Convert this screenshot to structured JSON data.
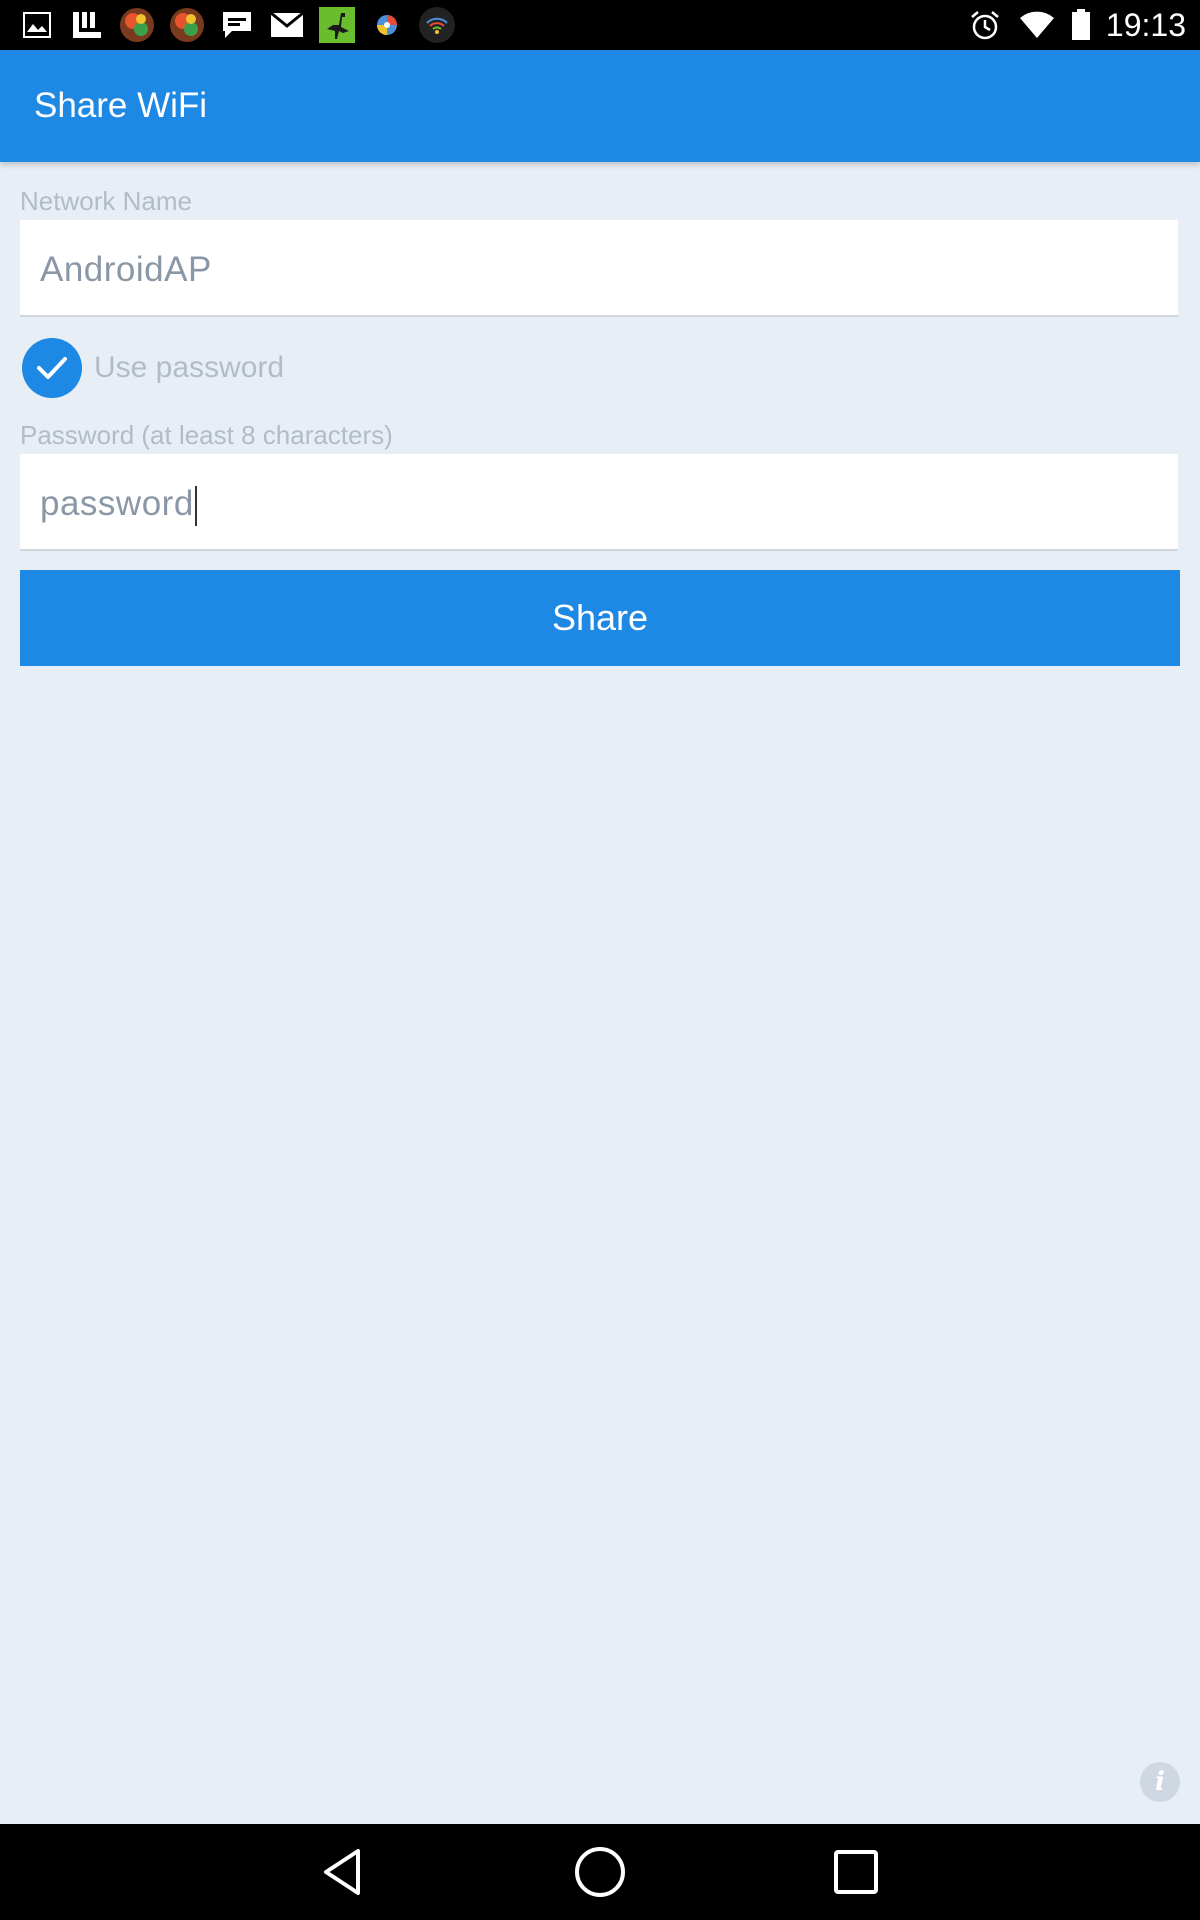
{
  "status_bar": {
    "time": "19:13",
    "notification_icons": [
      "image-icon",
      "app-icon",
      "game-icon",
      "game-icon",
      "chat-icon",
      "mail-icon",
      "ostrich-icon",
      "ball-icon",
      "wifi-app-icon"
    ],
    "status_icons": [
      "alarm-icon",
      "wifi-icon",
      "battery-icon"
    ]
  },
  "app_bar": {
    "title": "Share WiFi"
  },
  "form": {
    "network_name_label": "Network Name",
    "network_name_value": "AndroidAP",
    "use_password_label": "Use password",
    "use_password_checked": true,
    "password_label": "Password (at least 8 characters)",
    "password_value": "password",
    "share_button": "Share"
  },
  "info_button": {
    "glyph": "i"
  },
  "nav_bar": {
    "buttons": [
      "back-icon",
      "home-icon",
      "recents-icon"
    ]
  },
  "colors": {
    "primary": "#1e88e5",
    "background": "#e8eef6",
    "label": "#b2bcc8",
    "input_text": "#8a97a6"
  }
}
